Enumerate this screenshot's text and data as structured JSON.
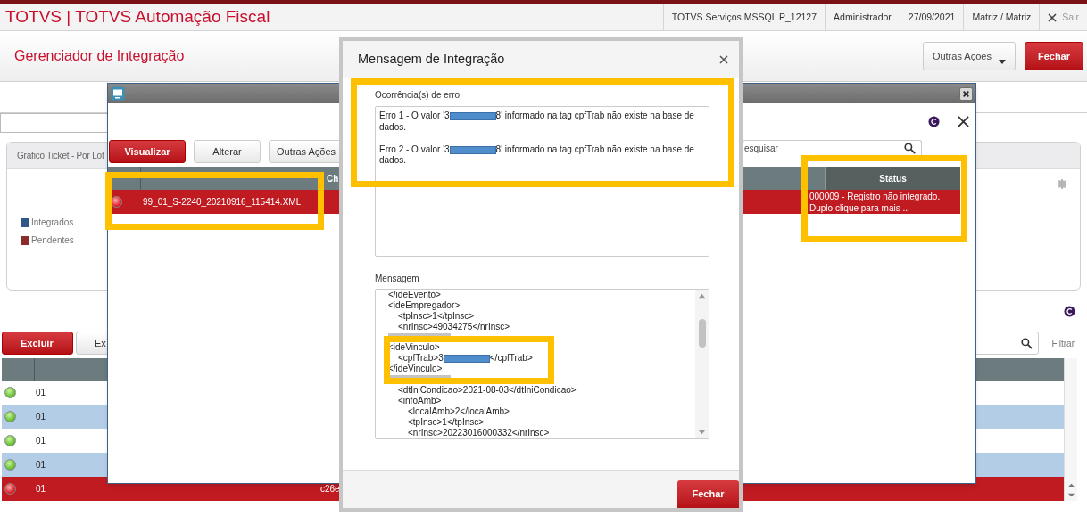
{
  "app_header": {
    "title": "TOTVS | TOTVS Automação Fiscal",
    "items": [
      "TOTVS Serviços MSSQL P_12127",
      "Administrador",
      "27/09/2021",
      "Matriz / Matriz"
    ],
    "logout": "Sair"
  },
  "page": {
    "title": "Gerenciador de Integração",
    "buttons": [
      {
        "label": "Outras Ações",
        "kind": "menu"
      },
      {
        "label": "Fechar",
        "kind": "primary"
      }
    ]
  },
  "chart_card": {
    "title": "Gráfico Ticket - Por Lot",
    "legend": [
      {
        "label": "Integrados",
        "color": "#2f5886"
      },
      {
        "label": "Pendentes",
        "color": "#8a2c2c"
      }
    ]
  },
  "lower_toolbar": {
    "buttons": [
      {
        "label": "Excluir",
        "kind": "primary"
      },
      {
        "label": "Ex",
        "kind": "secondary"
      }
    ],
    "filter": "Filtrar"
  },
  "lower_table": {
    "rows": [
      {
        "error": false,
        "column_2": "01",
        "selected": false
      },
      {
        "error": false,
        "column_2": "01",
        "selected": false
      },
      {
        "error": false,
        "column_2": "01",
        "selected": false
      },
      {
        "error": false,
        "column_2": "01",
        "selected": false
      },
      {
        "error": true,
        "column_2": "01",
        "column_3": "c26e",
        "selected": true
      }
    ]
  },
  "file_window": {
    "buttons": [
      {
        "label": "Visualizar",
        "kind": "primary"
      },
      {
        "label": "Alterar",
        "kind": "secondary"
      },
      {
        "label": "Outras Ações",
        "kind": "secondary"
      }
    ],
    "search": {
      "placeholder": "esquisar"
    },
    "columns": [
      "Ch",
      "Status"
    ],
    "rows": [
      {
        "error": true,
        "file": "99_01_S-2240_20210916_115414.XML",
        "message": "000009 - Registro não integrado. Duplo clique para mais ...",
        "selected": true
      }
    ]
  },
  "modal": {
    "title": "Mensagem de Integração",
    "errors_label": "Ocorrência(s) de erro",
    "errors": [
      {
        "text": "Erro 1 - O valor '3",
        "redacted": true,
        "text_after": "8' informado na tag cpfTrab não existe na base de",
        "continuation": "dados."
      },
      {
        "text": "Erro 2 - O valor '3",
        "redacted": true,
        "text_after": "8' informado na tag cpfTrab não existe na base de",
        "continuation": "dados."
      }
    ],
    "message_label": "Mensagem",
    "code": [
      {
        "text": "</ideEvento>"
      },
      {
        "text": "<ideEmpregador>",
        "children": [
          {
            "text": "<tpInsc>1</tpInsc>"
          },
          {
            "text": "<nrInsc>49034275</nrInsc>"
          }
        ]
      },
      {
        "kind": "covered"
      },
      {
        "text": "<ideVinculo>",
        "children": [
          {
            "text": "<cpfTrab>3",
            "redacted": true,
            "text_after": "</cpfTrab>"
          }
        ]
      },
      {
        "text": "</ideVinculo>"
      },
      {
        "kind": "covered",
        "children": [
          {
            "text": "<dtIniCondicao>2021-08-03</dtIniCondicao>"
          },
          {
            "text": "<infoAmb>",
            "children": [
              {
                "text": "<localAmb>2</localAmb>"
              },
              {
                "text": "<tpInsc>1</tpInsc>"
              },
              {
                "text": "<nrInsc>20223016000332</nrInsc>"
              }
            ]
          }
        ]
      }
    ],
    "button": "Fechar"
  }
}
